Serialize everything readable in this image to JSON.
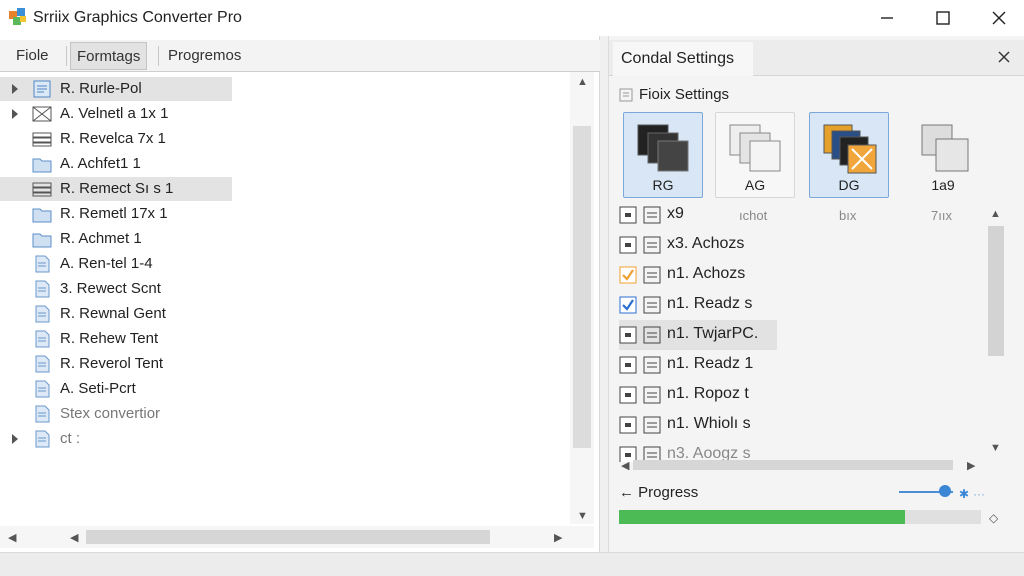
{
  "window": {
    "title": "Srriix Graphics Converter Pro",
    "minimize_icon": "minimize-icon",
    "maximize_icon": "maximize-icon",
    "close_icon": "close-icon"
  },
  "tabs": [
    {
      "label": "Fiole"
    },
    {
      "label": "Formtags",
      "active": true
    },
    {
      "label": "Progremos"
    }
  ],
  "tree": [
    {
      "label": "R. Rurle-Pol",
      "expander": true,
      "selected": true,
      "icon": "document-icon"
    },
    {
      "label": "A. Velnetl a 1x 1",
      "expander": true,
      "icon": "image-icon"
    },
    {
      "label": "R. Revelca 7x 1",
      "icon": "stack-icon"
    },
    {
      "label": "A. Achfet1 1",
      "icon": "folder-icon"
    },
    {
      "label": "R. Remect Sı s 1",
      "selected": true,
      "icon": "stack-icon"
    },
    {
      "label": "R. Remetl 17x 1",
      "icon": "folder-icon"
    },
    {
      "label": "R. Achmet 1",
      "icon": "folder-icon"
    },
    {
      "label": "A. Ren-tel 1-4",
      "icon": "file-icon"
    },
    {
      "label": "3. Rewect Scnt",
      "icon": "file-icon"
    },
    {
      "label": "R. Rewnal Gent",
      "icon": "file-icon"
    },
    {
      "label": "R. Rehew Tent",
      "icon": "file-icon"
    },
    {
      "label": "R. Reverol Tent",
      "icon": "file-icon"
    },
    {
      "label": "A. Seti-Pcrt",
      "icon": "file-icon"
    },
    {
      "label": "Stex convertior",
      "icon": "file-icon",
      "dim": true
    },
    {
      "label": "ct :",
      "expander": true,
      "icon": "file-icon",
      "dim": true
    }
  ],
  "settings_panel": {
    "tab_label": "Condal Settings",
    "section_title": "Fioix Settings",
    "formats": [
      {
        "label": "RG",
        "selected": true,
        "icon": "dark-pages-icon"
      },
      {
        "label": "AG",
        "icon": "light-pages-icon"
      },
      {
        "label": "DG",
        "selected": true,
        "icon": "color-pages-icon"
      },
      {
        "label": "1a9",
        "icon": "gray-pages-icon"
      }
    ],
    "sub_labels": [
      "x9",
      "ıchot",
      "bıx",
      "7ııx"
    ],
    "options": [
      {
        "label": "x9",
        "checked": false,
        "icon": "settings-icon"
      },
      {
        "label": "x3. Achozs",
        "checked": false,
        "icon": "edit-icon"
      },
      {
        "label": "n1. Achozs",
        "checked": true,
        "check_color": "#f0a030",
        "icon": "list-icon"
      },
      {
        "label": "n1. Readz s",
        "checked": true,
        "check_color": "#2c6fcf",
        "icon": "list-icon"
      },
      {
        "label": "n1. TwjarPC.",
        "checked": false,
        "highlight": true,
        "icon": "layers-icon"
      },
      {
        "label": "n1. Readz 1",
        "checked": false,
        "icon": "list-icon"
      },
      {
        "label": "n1. Ropoz t",
        "checked": false,
        "icon": "list-icon"
      },
      {
        "label": "n1. Whiolı s",
        "checked": false,
        "icon": "list-icon"
      },
      {
        "label": "n3. Aoogz s",
        "checked": false,
        "icon": "list-icon",
        "dim": true
      }
    ],
    "progress_label": "Progress",
    "progress_value": 0.79,
    "progress_color": "#4cbb56",
    "slider_value": 0.74
  }
}
